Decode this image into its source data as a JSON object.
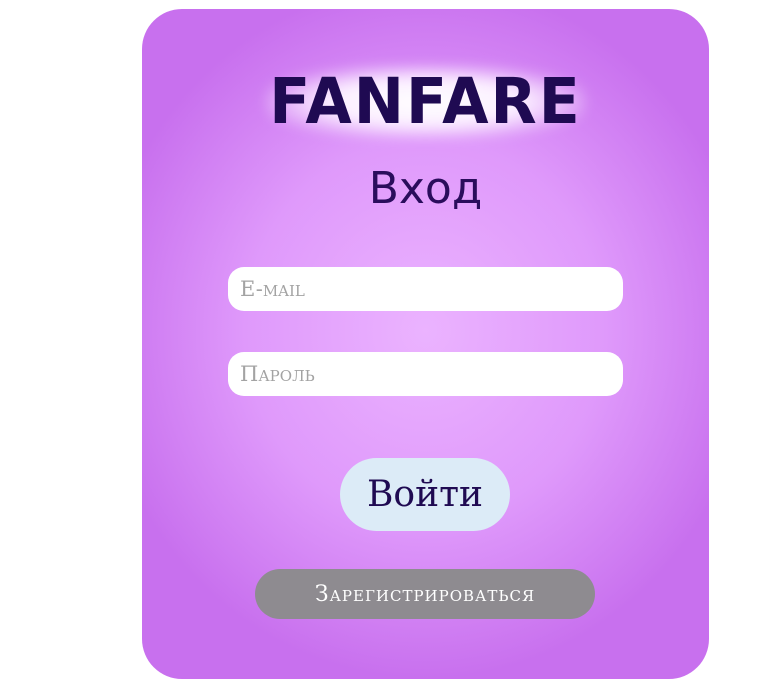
{
  "brand": {
    "logo_text": "FANFARE"
  },
  "form": {
    "title": "Вход",
    "email_placeholder": "E-mail",
    "password_placeholder": "Пароль",
    "login_label": "Войти",
    "register_label": "Зарегистрироваться"
  },
  "colors": {
    "card_center": "#ebb3ff",
    "card_edge": "#c870ee",
    "logo_text": "#1f0a52",
    "login_button_bg": "#dcebf7",
    "register_button_bg": "#8e8b90"
  }
}
